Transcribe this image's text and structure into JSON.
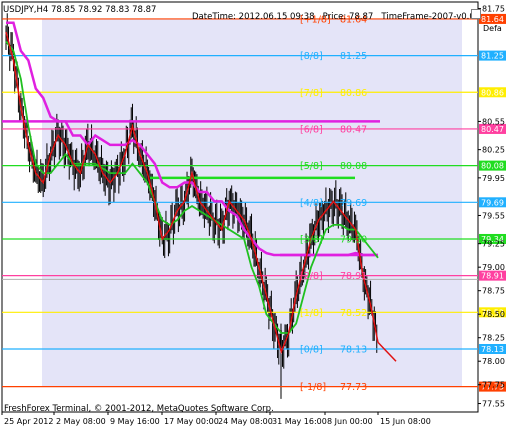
{
  "header": {
    "symbol": "USDJPY,H4",
    "ohlc": "78.85 78.92 78.83 78.87",
    "datetime": "DateTime: 2012.06.15 09:38",
    "price": "Price: 78.87",
    "timeframe": "TimeFrame-2007-v0.05",
    "corner": "Defa"
  },
  "footer": "FreshForex Terminal, © 2001-2012, MetaQuotes Software Corp.",
  "colors": {
    "background": "#ffffff",
    "shade": "#e4e4f8",
    "candle": "#000000",
    "close_line": "#e01010",
    "ma_slow": "#e020e0",
    "ma_fast": "#20c020"
  },
  "chart_data": {
    "type": "line",
    "symbol": "USDJPY",
    "timeframe": "H4",
    "ylim": [
      77.46,
      81.82
    ],
    "price_ticks": [
      "81.75",
      "81.64",
      "81.25",
      "80.86",
      "80.55",
      "80.47",
      "80.25",
      "80.08",
      "79.95",
      "79.69",
      "79.55",
      "79.34",
      "79.25",
      "79.00",
      "78.91",
      "78.75",
      "78.52",
      "78.50",
      "78.25",
      "78.13",
      "78.00",
      "77.75",
      "77.73",
      "77.55"
    ],
    "time_labels": [
      "25 Apr 2012",
      "2 May 08:00",
      "9 May 16:00",
      "17 May 00:00",
      "24 May 08:00",
      "31 May 16:00",
      "8 Jun 00:00",
      "15 Jun 08:00"
    ],
    "murray_levels": [
      {
        "label": "[+1/8]",
        "value": "81.64",
        "price": 81.64,
        "color": "#ff4000",
        "badge": "81.64"
      },
      {
        "label": "[8/8]",
        "value": "81.25",
        "price": 81.25,
        "color": "#20b0ff",
        "badge": "81.25"
      },
      {
        "label": "[7/8]",
        "value": "80.86",
        "price": 80.86,
        "color": "#ffee00",
        "badge": "80.86"
      },
      {
        "label": "[6/8]",
        "value": "80.47",
        "price": 80.47,
        "color": "#ff40a0",
        "badge": "80.47"
      },
      {
        "label": "[5/8]",
        "value": "80.08",
        "price": 80.08,
        "color": "#20dd20",
        "badge": "80.08"
      },
      {
        "label": "[4/8]",
        "value": "79.69",
        "price": 79.69,
        "color": "#20b0ff",
        "badge": "79.69"
      },
      {
        "label": "[3/8]",
        "value": "79.30",
        "price": 79.3,
        "color": "#20dd20",
        "badge": "79.34"
      },
      {
        "label": "[2/8]",
        "value": "78.91",
        "price": 78.91,
        "color": "#ff40a0",
        "badge": "78.91"
      },
      {
        "label": "[1/8]",
        "value": "78.52",
        "price": 78.52,
        "color": "#ffee00",
        "badge": "78.52"
      },
      {
        "label": "[0/8]",
        "value": "78.13",
        "price": 78.13,
        "color": "#20b0ff",
        "badge": "78.13"
      },
      {
        "label": "[-1/8]",
        "value": "77.73",
        "price": 77.73,
        "color": "#ff4000",
        "badge": "77.73"
      }
    ],
    "extra_lines": [
      {
        "price": 80.55,
        "color": "#e020e0"
      },
      {
        "price": 79.95,
        "color": "#20dd20"
      },
      {
        "price": 79.13,
        "color": "#e020e0"
      },
      {
        "price": 78.87,
        "color": "#b0b0b0"
      }
    ],
    "close": [
      81.5,
      81.2,
      80.7,
      80.3,
      80.0,
      79.9,
      80.2,
      80.4,
      80.3,
      80.1,
      80.0,
      80.3,
      80.2,
      80.0,
      79.9,
      80.0,
      80.2,
      80.5,
      80.2,
      80.0,
      79.7,
      79.3,
      79.4,
      79.6,
      79.7,
      80.0,
      79.7,
      79.6,
      79.5,
      79.4,
      79.7,
      79.6,
      79.5,
      79.3,
      79.0,
      78.7,
      78.4,
      78.1,
      78.3,
      78.7,
      79.0,
      79.3,
      79.5,
      79.6,
      79.7,
      79.6,
      79.5,
      79.4,
      78.9,
      78.6,
      78.2
    ],
    "ma_fast": [
      81.4,
      81.3,
      81.0,
      80.5,
      80.1,
      80.0,
      80.0,
      80.1,
      80.2,
      80.1,
      80.1,
      80.1,
      80.1,
      80.05,
      80.0,
      80.0,
      80.0,
      80.1,
      80.0,
      79.9,
      79.7,
      79.5,
      79.45,
      79.5,
      79.6,
      79.65,
      79.6,
      79.55,
      79.5,
      79.45,
      79.4,
      79.35,
      79.3,
      79.0,
      78.8,
      78.5,
      78.4,
      78.3,
      78.3,
      78.4,
      78.7,
      79.0,
      79.2,
      79.4,
      79.45,
      79.45,
      79.4,
      79.4,
      79.3,
      79.2,
      79.1
    ],
    "ma_slow": [
      81.6,
      81.6,
      81.3,
      81.2,
      80.9,
      80.8,
      80.6,
      80.55,
      80.55,
      80.4,
      80.4,
      80.3,
      80.4,
      80.35,
      80.3,
      80.3,
      80.3,
      80.35,
      80.3,
      80.2,
      80.1,
      79.9,
      79.85,
      79.85,
      79.9,
      79.9,
      79.8,
      79.8,
      79.7,
      79.7,
      79.6,
      79.55,
      79.4,
      79.3,
      79.2,
      79.15,
      79.13,
      79.13,
      79.13,
      79.13,
      79.13,
      79.13,
      79.13,
      79.13,
      79.13,
      79.13,
      79.13,
      79.15,
      79.13,
      79.13,
      79.13
    ]
  }
}
